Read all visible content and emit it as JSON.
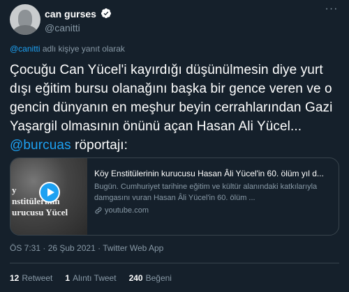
{
  "author": {
    "name": "can gurses",
    "handle": "@canitti",
    "verified": true
  },
  "reply_to": {
    "mention": "@canitti",
    "suffix": "adlı kişiye yanıt olarak"
  },
  "tweet": {
    "line1": "Çocuğu Can Yücel'i kayırdığı düşünülmesin diye yurt",
    "line2": "dışı eğitim bursu olanağını başka bir gence veren ve o",
    "line3": "gencin dünyanın en meşhur beyin cerrahlarından Gazi",
    "line4": "Yaşargil olmasının önünü açan Hasan Ali Yücel...",
    "mention": "@burcuas",
    "mention_suffix": "röportajı:"
  },
  "card": {
    "thumb_line1": "y",
    "thumb_line2": "nstitülerinin",
    "thumb_line3": "urucusu Yücel",
    "title": "Köy Enstitülerinin kurucusu Hasan Âli Yücel'in 60. ölüm yıl d...",
    "description": "Bugün. Cumhuriyet tarihine eğitim ve kültür alanındaki katkılarıyla damgasını vuran Hasan Âli Yücel'in 60. ölüm ...",
    "domain": "youtube.com"
  },
  "meta": "ÖS 7:31 · 26 Şub 2021 · Twitter Web App",
  "stats": {
    "retweets_count": "12",
    "retweets_label": "Retweet",
    "quotes_count": "1",
    "quotes_label": "Alıntı Tweet",
    "likes_count": "240",
    "likes_label": "Beğeni"
  },
  "colors": {
    "background": "#15202b",
    "accent": "#1da1f2",
    "secondary_text": "#8899a6",
    "border": "#38444d"
  }
}
